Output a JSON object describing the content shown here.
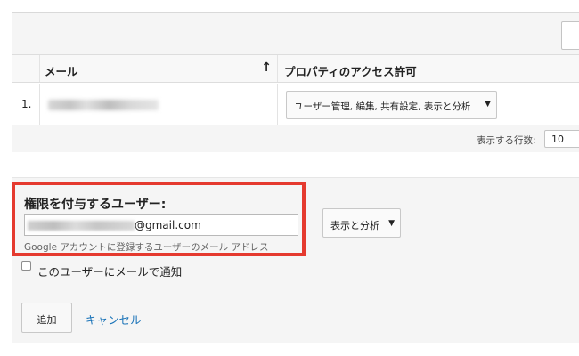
{
  "table": {
    "header": {
      "email_label": "メール",
      "sort_icon": "↑",
      "permission_label": "プロパティのアクセス許可"
    },
    "rows": [
      {
        "index": "1.",
        "email": "",
        "permissions": "ユーザー管理, 編集, 共有設定, 表示と分析"
      }
    ],
    "footer": {
      "rows_label": "表示する行数:",
      "rows_value": "10"
    }
  },
  "grant": {
    "label": "権限を付与するユーザー:",
    "email_suffix": "@gmail.com",
    "help_text": "Google アカウントに登録するユーザーのメール アドレス",
    "role_value": "表示と分析",
    "notify_label": "このユーザーにメールで通知",
    "notify_checked": false,
    "add_label": "追加",
    "cancel_label": "キャンセル"
  },
  "icons": {
    "caret": "▼",
    "sort": "arrow-up-icon"
  },
  "colors": {
    "highlight": "#e53a2f",
    "link": "#1a73b8"
  }
}
